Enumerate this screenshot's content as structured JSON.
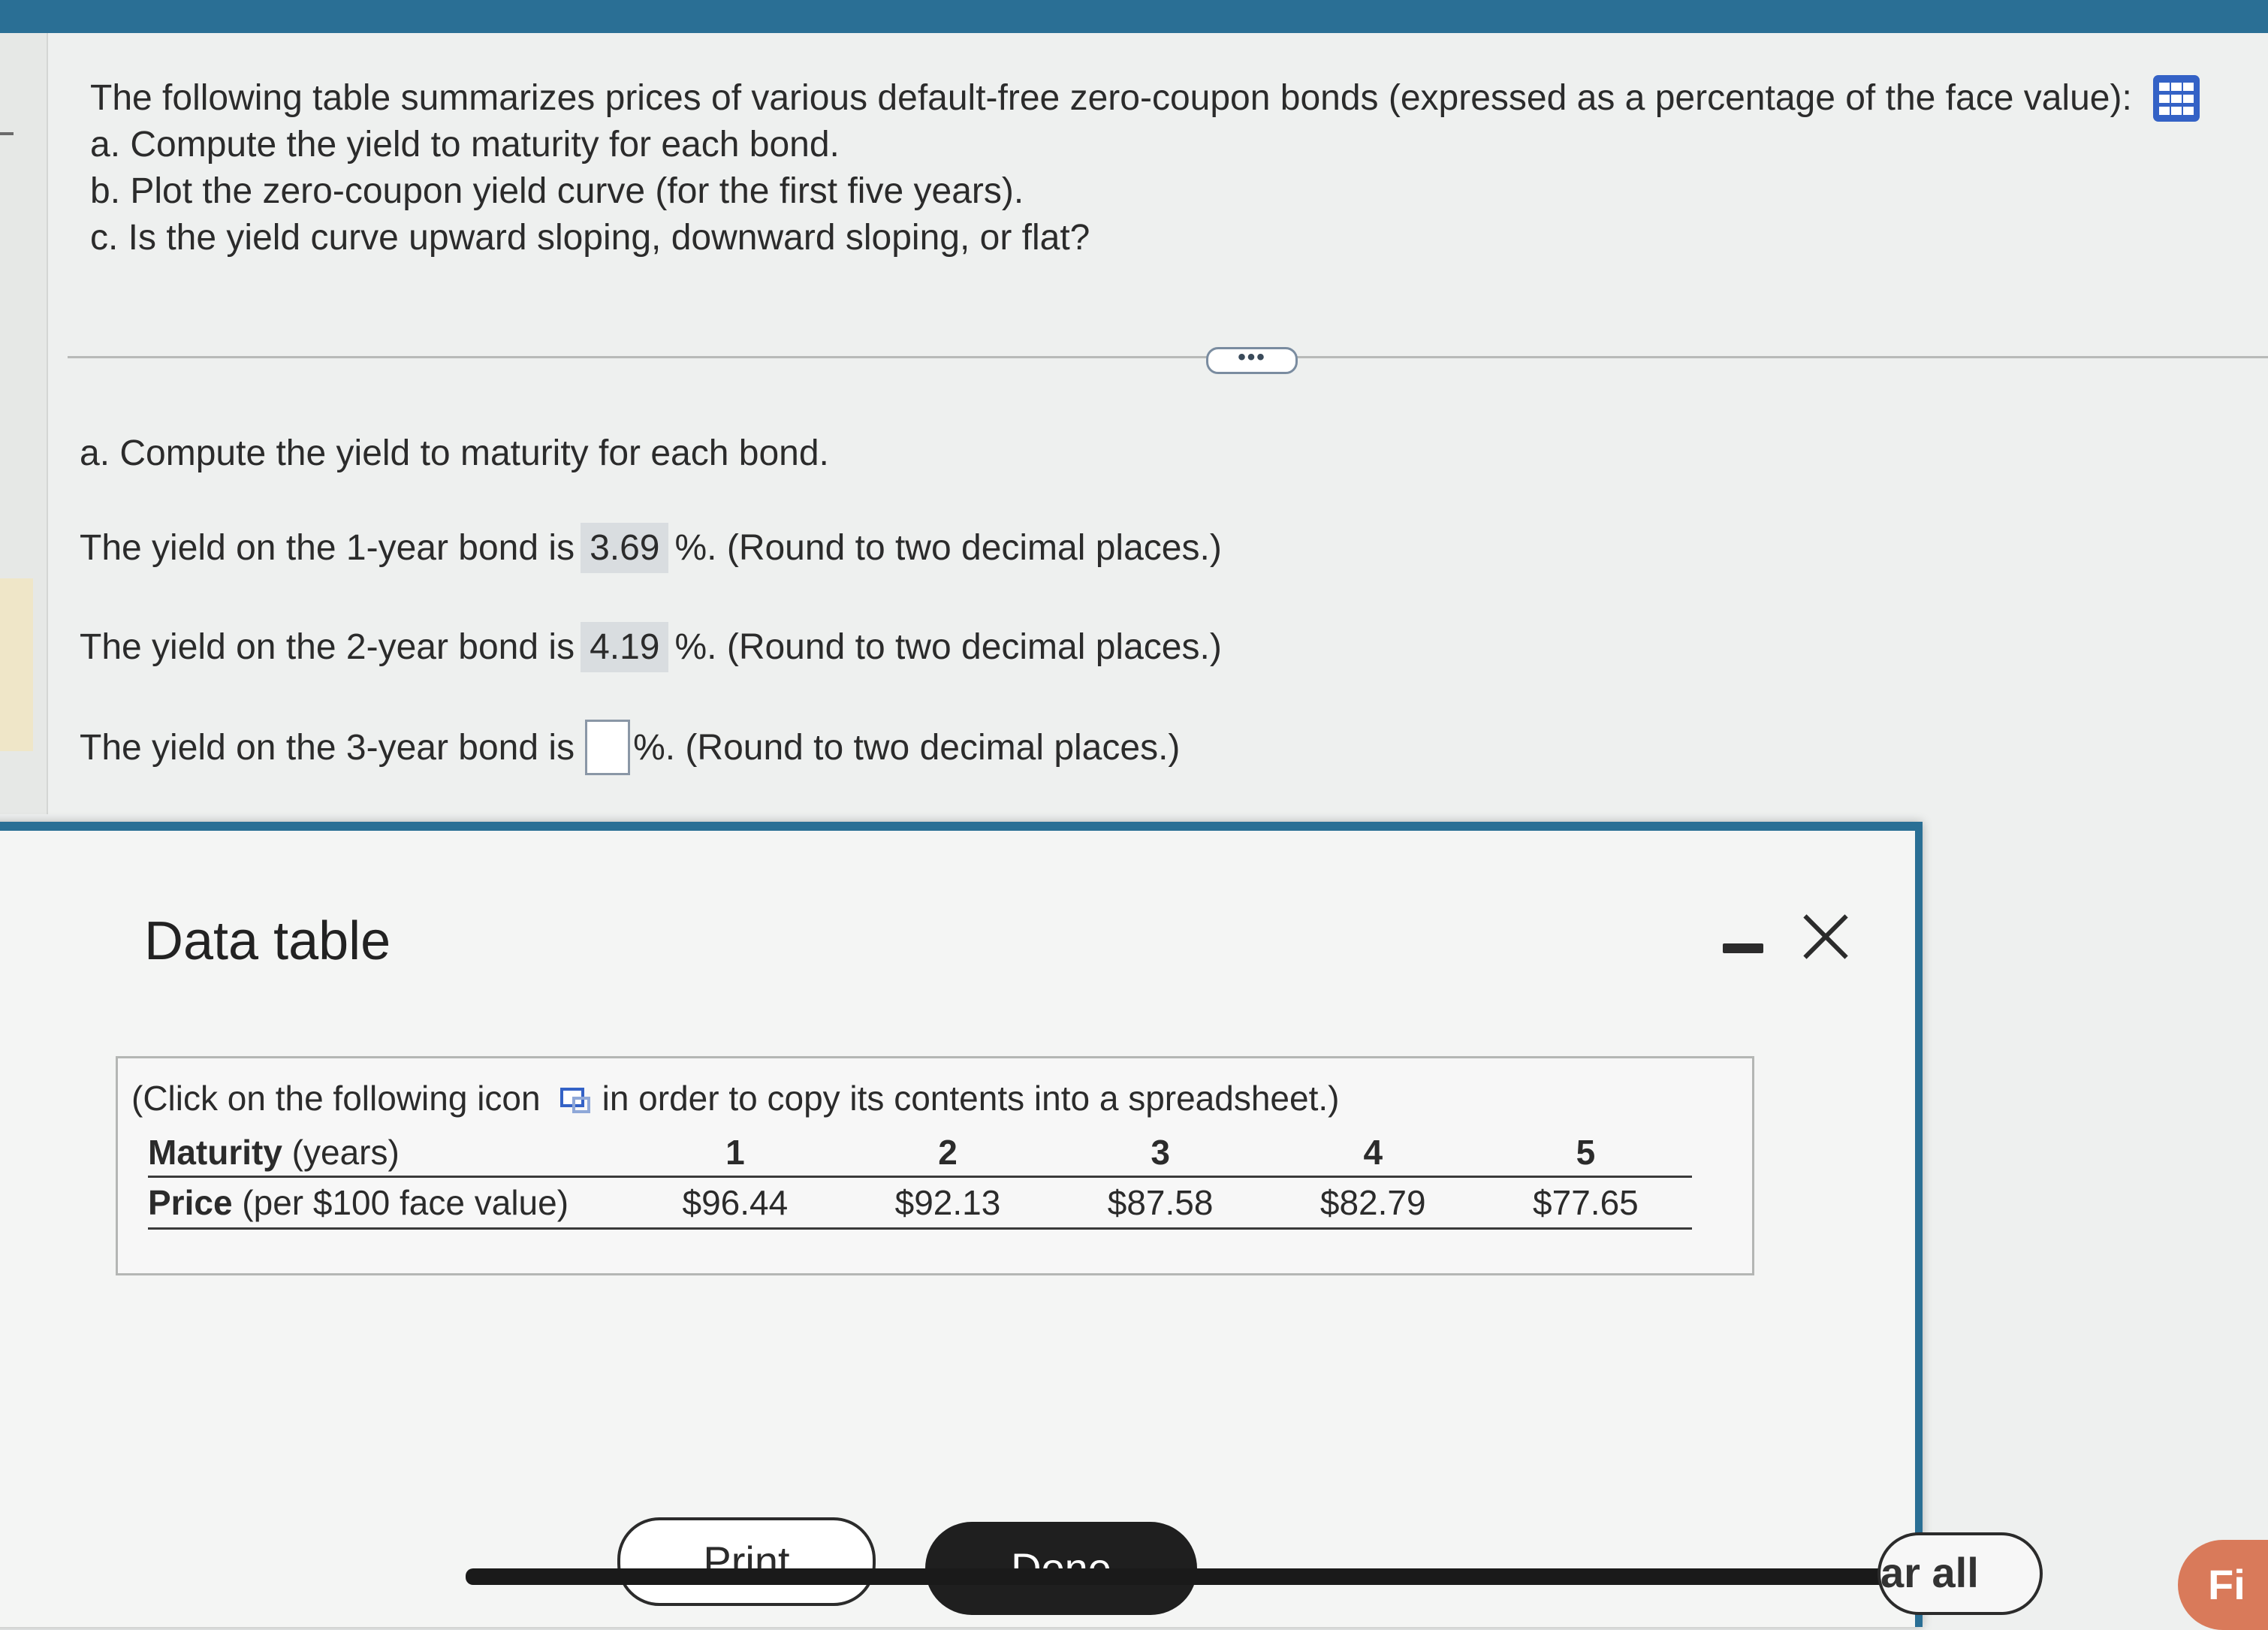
{
  "question": {
    "intro": "The following table summarizes prices of various default-free zero-coupon bonds (expressed as a percentage of the face value):",
    "parts": [
      "a. Compute the yield to maturity for each bond.",
      "b. Plot the zero-coupon yield curve (for the first five years).",
      "c. Is the yield curve upward sloping, downward sloping, or flat?"
    ],
    "table_icon": "grid-icon"
  },
  "divider": {
    "ellipsis": "•••"
  },
  "answer": {
    "heading": "a. Compute the yield to maturity for each bond.",
    "yields": [
      {
        "prefix": "The yield on the 1-year bond is",
        "value": "3.69",
        "suffix": "%. (Round to two decimal places.)"
      },
      {
        "prefix": "The yield on the 2-year bond is",
        "value": "4.19",
        "suffix": "%. (Round to two decimal places.)"
      },
      {
        "prefix": "The yield on the 3-year bond is",
        "value": "",
        "suffix": "%. (Round to two decimal places.)"
      }
    ]
  },
  "dialog": {
    "title": "Data table",
    "note_before": "(Click on the following icon",
    "note_after": "in order to copy its contents into a spreadsheet.)",
    "table": {
      "maturity_label_bold": "Maturity",
      "maturity_label_rest": " (years)",
      "price_label_bold": "Price",
      "price_label_rest": " (per $100 face value)",
      "maturities": [
        "1",
        "2",
        "3",
        "4",
        "5"
      ],
      "prices": [
        "$96.44",
        "$92.13",
        "$87.58",
        "$82.79",
        "$77.65"
      ]
    },
    "print_label": "Print",
    "done_label": "Done"
  },
  "footer": {
    "clear_all_label": "ar all",
    "fix_label": "Fi"
  }
}
